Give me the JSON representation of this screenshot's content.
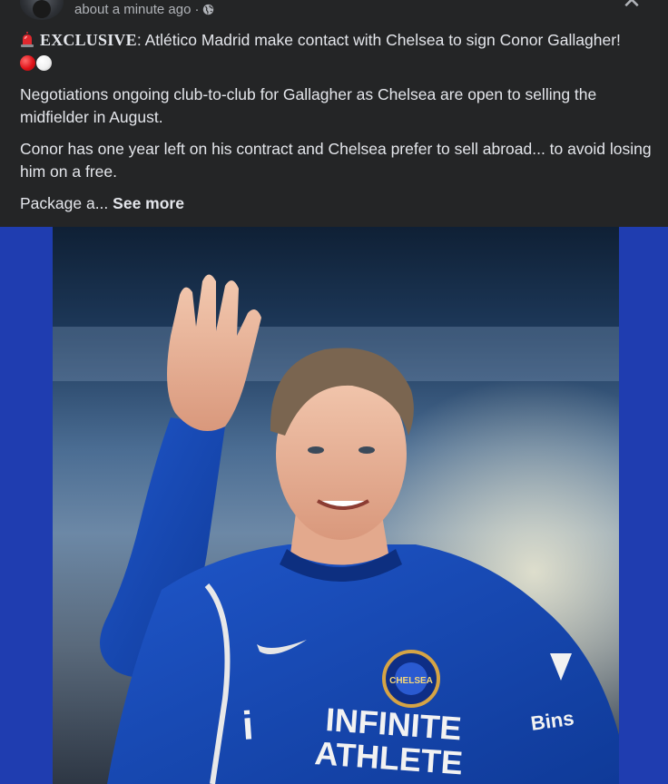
{
  "post": {
    "timestamp": "about a minute ago",
    "separator": "·",
    "privacy_icon": "globe-icon",
    "close_glyph": "✕",
    "headline_tag": "EXCLUSIVE",
    "headline_text": ": Atlético Madrid make contact with Chelsea to sign Conor Gallagher!",
    "paragraph_1": "Negotiations ongoing club-to-club for Gallagher as Chelsea are open to selling the midfielder in August.",
    "paragraph_2": "Conor has one year left on his contract and Chelsea prefer to sell abroad... to avoid losing him on a free.",
    "paragraph_3": "Package a...",
    "see_more": "See more"
  },
  "photo": {
    "shirt_sponsor_line1": "INFINITE",
    "shirt_sponsor_line2": "ATHLETE",
    "sleeve_text": "Bins",
    "crest_text": "CHELSEA",
    "frame_color": "#1f3db0",
    "shirt_color": "#1546b6"
  }
}
